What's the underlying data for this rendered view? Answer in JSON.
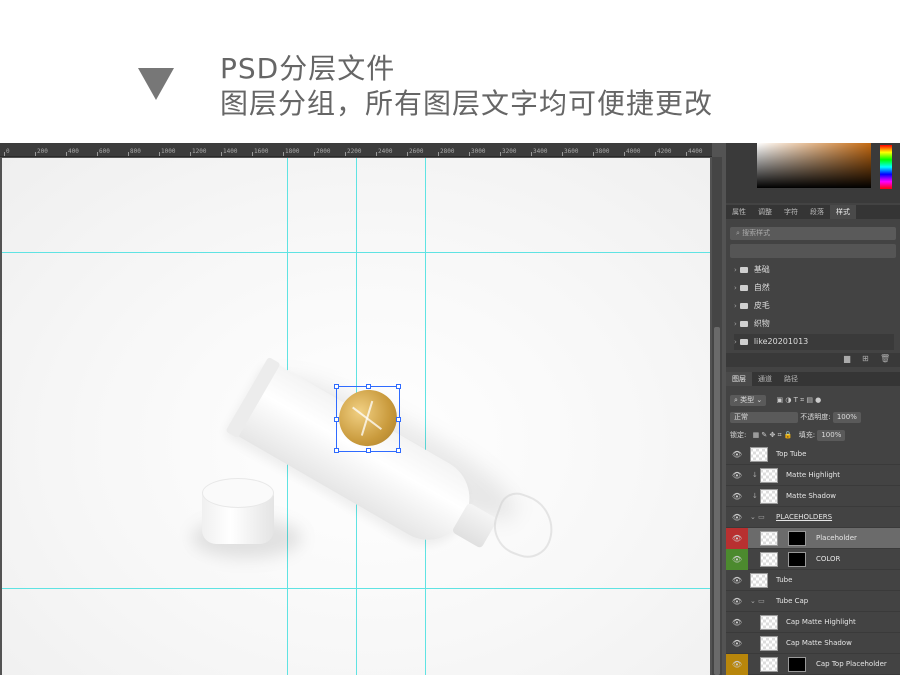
{
  "header": {
    "line1": "PSD分层文件",
    "line2": "图层分组，所有图层文字均可便捷更改"
  },
  "ruler": {
    "ticks": [
      "0",
      "200",
      "400",
      "600",
      "800",
      "1000",
      "1200",
      "1400",
      "1600",
      "1800",
      "2000",
      "2200",
      "2400",
      "2600",
      "2800",
      "3000",
      "3200",
      "3400",
      "3600",
      "3800",
      "4000",
      "4200",
      "4400"
    ]
  },
  "panel": {
    "props_tabs": [
      "属性",
      "调整",
      "字符",
      "段落",
      "样式"
    ],
    "active_props_tab": "样式",
    "search_placeholder": "搜索样式",
    "style_folders": [
      "基础",
      "自然",
      "皮毛",
      "织物",
      "like20201013"
    ],
    "layer_tabs": [
      "图层",
      "通道",
      "路径"
    ],
    "active_layer_tab": "图层",
    "filter_kind": "类型",
    "blend_mode": "正常",
    "opacity_label": "不透明度:",
    "opacity_value": "100%",
    "lock_label": "锁定:",
    "fill_label": "填充:",
    "fill_value": "100%"
  },
  "layers": [
    {
      "name": "Top Tube",
      "indent": 0,
      "color": "",
      "mask": false,
      "group": false,
      "clip": false
    },
    {
      "name": "Matte Highlight",
      "indent": 1,
      "color": "",
      "mask": false,
      "group": false,
      "clip": true
    },
    {
      "name": "Matte Shadow",
      "indent": 1,
      "color": "",
      "mask": false,
      "group": false,
      "clip": true
    },
    {
      "name": "PLACEHOLDERS",
      "indent": 0,
      "color": "",
      "mask": false,
      "group": true,
      "clip": false
    },
    {
      "name": "Placeholder",
      "indent": 1,
      "color": "red",
      "mask": true,
      "group": false,
      "clip": false,
      "active": true
    },
    {
      "name": "COLOR",
      "indent": 1,
      "color": "green",
      "mask": true,
      "group": false,
      "clip": false
    },
    {
      "name": "Tube",
      "indent": 0,
      "color": "",
      "mask": false,
      "group": false,
      "clip": false
    },
    {
      "name": "Tube Cap",
      "indent": 0,
      "color": "",
      "mask": false,
      "group": true,
      "clip": false
    },
    {
      "name": "Cap Matte Highlight",
      "indent": 1,
      "color": "",
      "mask": false,
      "group": false,
      "clip": false
    },
    {
      "name": "Cap Matte Shadow",
      "indent": 1,
      "color": "",
      "mask": false,
      "group": false,
      "clip": false
    },
    {
      "name": "Cap Top Placeholder",
      "indent": 1,
      "color": "orange",
      "mask": true,
      "group": false,
      "clip": false
    }
  ],
  "colors": {
    "guide": "#5fe3e3",
    "selection": "#2f6bff",
    "label_gold": "#c99a3c"
  }
}
